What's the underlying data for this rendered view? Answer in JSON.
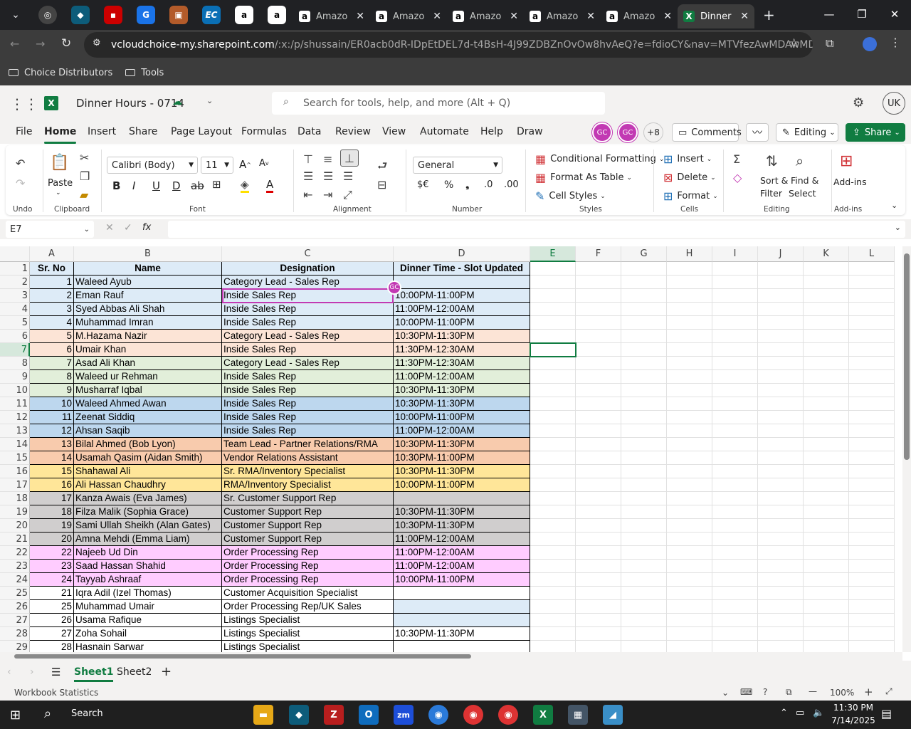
{
  "browser": {
    "tabs": [
      {
        "label": "Amazo",
        "icon": "amazon-icon"
      },
      {
        "label": "Amazo",
        "icon": "amazon-icon"
      },
      {
        "label": "Amazo",
        "icon": "amazon-icon"
      },
      {
        "label": "Amazo",
        "icon": "amazon-icon"
      },
      {
        "label": "Amazo",
        "icon": "amazon-icon"
      },
      {
        "label": "Dinner",
        "icon": "excel-icon"
      }
    ],
    "url_host": "vcloudchoice-my.sharepoint.com",
    "url_rest": "/:x:/p/shussain/ER0acb0dR-IDpEtDEL7d-t4BsH-4J99ZDBZnOvOw8hvAeQ?e=fdioCY&nav=MTVfezAwMDAwMDAwLTA...",
    "bookmarks": [
      "Choice Distributors",
      "Tools"
    ]
  },
  "excel": {
    "file_title": "Dinner Hours - 0714",
    "search_placeholder": "Search for tools, help, and more (Alt + Q)",
    "user_initials": "UK",
    "menu": [
      "File",
      "Home",
      "Insert",
      "Share",
      "Page Layout",
      "Formulas",
      "Data",
      "Review",
      "View",
      "Automate",
      "Help",
      "Draw"
    ],
    "collab": {
      "avatar1": "GC",
      "avatar2": "GC",
      "more": "+8"
    },
    "comments_label": "Comments",
    "editing_label": "Editing",
    "share_label": "Share",
    "ribbon": {
      "paste": "Paste",
      "font_name": "Calibri (Body)",
      "font_size": "11",
      "number_format": "General",
      "conditional_formatting": "Conditional Formatting",
      "format_as_table": "Format As Table",
      "cell_styles": "Cell Styles",
      "insert": "Insert",
      "delete": "Delete",
      "format": "Format",
      "sort_filter_1": "Sort &",
      "sort_filter_2": "Filter",
      "find_select_1": "Find &",
      "find_select_2": "Select",
      "addins": "Add-ins",
      "groups": {
        "undo": "Undo",
        "clipboard": "Clipboard",
        "font": "Font",
        "alignment": "Alignment",
        "number": "Number",
        "styles": "Styles",
        "cells": "Cells",
        "editing": "Editing",
        "addins": "Add-ins"
      }
    },
    "name_box": "E7",
    "columns": [
      "A",
      "B",
      "C",
      "D",
      "E",
      "F",
      "G",
      "H",
      "I",
      "J",
      "K",
      "L"
    ],
    "header_row": [
      "Sr. No",
      "Name",
      "Designation",
      "Dinner Time - Slot Updated"
    ],
    "cursor_tag": "GC",
    "rows": [
      {
        "n": "1",
        "name": "Waleed Ayub",
        "designation": "Category Lead - Sales Rep",
        "time": "",
        "color": "#ddebf7"
      },
      {
        "n": "2",
        "name": "Eman Rauf",
        "designation": "Inside Sales Rep",
        "time": "10:00PM-11:00PM",
        "color": "#ddebf7"
      },
      {
        "n": "3",
        "name": "Syed Abbas Ali Shah",
        "designation": "Inside Sales Rep",
        "time": "11:00PM-12:00AM",
        "color": "#ddebf7"
      },
      {
        "n": "4",
        "name": "Muhammad Imran",
        "designation": "Inside Sales Rep",
        "time": "10:00PM-11:00PM",
        "color": "#ddebf7"
      },
      {
        "n": "5",
        "name": "M.Hazama Nazir",
        "designation": "Category Lead - Sales Rep",
        "time": "10:30PM-11:30PM",
        "color": "#fce4d6"
      },
      {
        "n": "6",
        "name": "Umair Khan",
        "designation": "Inside Sales Rep",
        "time": "11:30PM-12:30AM",
        "color": "#fce4d6"
      },
      {
        "n": "7",
        "name": "Asad Ali Khan",
        "designation": "Category Lead - Sales Rep",
        "time": "11:30PM-12:30AM",
        "color": "#e2efda"
      },
      {
        "n": "8",
        "name": "Waleed ur Rehman",
        "designation": "Inside Sales Rep",
        "time": "11:00PM-12:00AM",
        "color": "#e2efda"
      },
      {
        "n": "9",
        "name": "Musharraf Iqbal",
        "designation": "Inside Sales Rep",
        "time": "10:30PM-11:30PM",
        "color": "#e2efda"
      },
      {
        "n": "10",
        "name": "Waleed Ahmed Awan",
        "designation": "Inside Sales Rep",
        "time": "10:30PM-11:30PM",
        "color": "#bdd7ee"
      },
      {
        "n": "11",
        "name": "Zeenat Siddiq",
        "designation": "Inside Sales Rep",
        "time": "10:00PM-11:00PM",
        "color": "#bdd7ee"
      },
      {
        "n": "12",
        "name": "Ahsan Saqib",
        "designation": "Inside Sales Rep",
        "time": "11:00PM-12:00AM",
        "color": "#bdd7ee"
      },
      {
        "n": "13",
        "name": "Bilal Ahmed (Bob Lyon)",
        "designation": "Team Lead - Partner Relations/RMA",
        "time": "10:30PM-11:30PM",
        "color": "#f8cbad"
      },
      {
        "n": "14",
        "name": "Usamah Qasim (Aidan Smith)",
        "designation": "Vendor Relations Assistant",
        "time": "10:30PM-11:00PM",
        "color": "#f8cbad"
      },
      {
        "n": "15",
        "name": "Shahawal Ali",
        "designation": "Sr. RMA/Inventory Specialist",
        "time": "10:30PM-11:30PM",
        "color": "#ffe699"
      },
      {
        "n": "16",
        "name": "Ali Hassan Chaudhry",
        "designation": "RMA/Inventory Specialist",
        "time": "10:00PM-11:00PM",
        "color": "#ffe699"
      },
      {
        "n": "17",
        "name": "Kanza Awais (Eva James)",
        "designation": "Sr. Customer Support Rep",
        "time": "",
        "color": "#d0cece"
      },
      {
        "n": "18",
        "name": "Filza Malik (Sophia Grace)",
        "designation": "Customer Support Rep",
        "time": "10:30PM-11:30PM",
        "color": "#d0cece"
      },
      {
        "n": "19",
        "name": "Sami Ullah Sheikh (Alan Gates)",
        "designation": "Customer Support Rep",
        "time": "10:30PM-11:30PM",
        "color": "#d0cece"
      },
      {
        "n": "20",
        "name": "Amna Mehdi (Emma Liam)",
        "designation": "Customer Support Rep",
        "time": "11:00PM-12:00AM",
        "color": "#d0cece"
      },
      {
        "n": "22",
        "name": "Najeeb Ud Din",
        "designation": "Order Processing Rep",
        "time": "11:00PM-12:00AM",
        "color": "#ffccff"
      },
      {
        "n": "23",
        "name": "Saad Hassan Shahid",
        "designation": "Order Processing Rep",
        "time": "11:00PM-12:00AM",
        "color": "#ffccff"
      },
      {
        "n": "24",
        "name": "Tayyab Ashraaf",
        "designation": "Order Processing Rep",
        "time": "10:00PM-11:00PM",
        "color": "#ffccff"
      },
      {
        "n": "21",
        "name": "Iqra Adil (Izel Thomas)",
        "designation": "Customer Acquisition Specialist",
        "time": "",
        "color": "#ffffff"
      },
      {
        "n": "25",
        "name": "Muhammad Umair",
        "designation": "Order Processing Rep/UK Sales",
        "time": "",
        "color": "#ffffff",
        "time_color": "#ddebf7"
      },
      {
        "n": "26",
        "name": "Usama Rafique",
        "designation": "Listings Specialist",
        "time": "",
        "color": "#ffffff",
        "time_color": "#ddebf7"
      },
      {
        "n": "27",
        "name": "Zoha Sohail",
        "designation": "Listings Specialist",
        "time": "10:30PM-11:30PM",
        "color": "#ffffff"
      },
      {
        "n": "28",
        "name": "Hasnain Sarwar",
        "designation": "Listings Specialist",
        "time": "",
        "color": "#ffffff"
      }
    ],
    "sheets": [
      "Sheet1",
      "Sheet2"
    ],
    "status_left": "Workbook Statistics",
    "zoom": "100%"
  },
  "taskbar": {
    "search": "Search",
    "time": "11:30 PM",
    "date": "7/14/2025"
  }
}
